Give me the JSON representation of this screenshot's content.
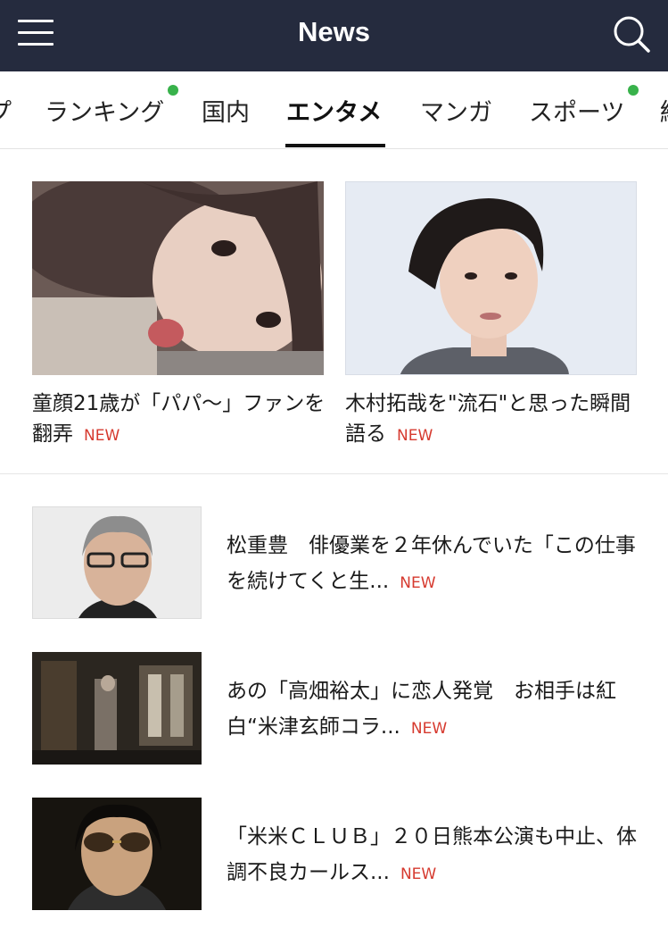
{
  "header": {
    "title": "News"
  },
  "tabs": [
    {
      "label": "プ",
      "active": false
    },
    {
      "label": "ランキング",
      "active": false,
      "has_dot": true
    },
    {
      "label": "国内",
      "active": false
    },
    {
      "label": "エンタメ",
      "active": true
    },
    {
      "label": "マンガ",
      "active": false
    },
    {
      "label": "スポーツ",
      "active": false,
      "has_dot": true
    },
    {
      "label": "経",
      "active": false
    }
  ],
  "featured": [
    {
      "title": "童顔21歳が「パパ〜」ファンを翻弄",
      "badge": "NEW"
    },
    {
      "title": "木村拓哉を\"流石\"と思った瞬間語る",
      "badge": "NEW"
    }
  ],
  "list": [
    {
      "title": "松重豊　俳優業を２年休んでいた「この仕事を続けてくと生...",
      "badge": "NEW"
    },
    {
      "title": "あの「高畑裕太」に恋人発覚　お相手は紅白“米津玄師コラ...",
      "badge": "NEW"
    },
    {
      "title": "「米米ＣＬＵＢ」２０日熊本公演も中止、体調不良カールス...",
      "badge": "NEW"
    }
  ],
  "colors": {
    "header_bg": "#252b3e",
    "new_badge": "#d63a2f",
    "tab_dot": "#38b24b"
  }
}
